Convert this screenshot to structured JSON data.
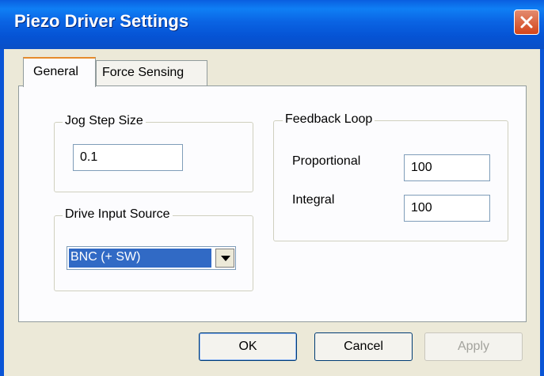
{
  "window": {
    "title": "Piezo Driver Settings"
  },
  "tabs": [
    {
      "label": "General"
    },
    {
      "label": "Force Sensing"
    }
  ],
  "jog": {
    "legend": "Jog Step Size",
    "value": "0.1"
  },
  "feedback": {
    "legend": "Feedback Loop",
    "proportional_label": "Proportional",
    "proportional_value": "100",
    "integral_label": "Integral",
    "integral_value": "100"
  },
  "drive": {
    "legend": "Drive Input Source",
    "selected": "BNC (+ SW)"
  },
  "buttons": {
    "ok": "OK",
    "cancel": "Cancel",
    "apply": "Apply"
  },
  "colors": {
    "titlebar": "#0a5fe0",
    "close": "#d4441a",
    "selection": "#316ac5",
    "tab_highlight": "#e68b2c"
  },
  "icons": {
    "close": "close-icon",
    "dropdown": "chevron-down-icon"
  }
}
